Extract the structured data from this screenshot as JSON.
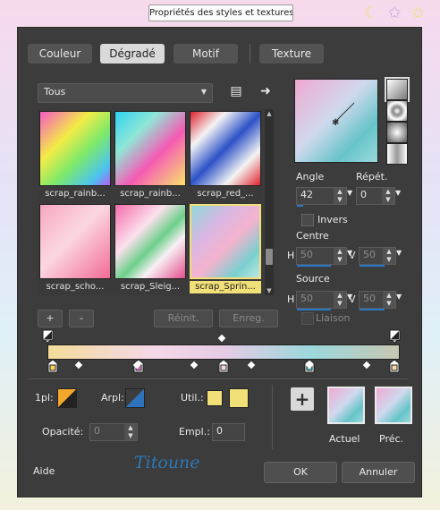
{
  "window": {
    "title": "Propriétés des styles et textures"
  },
  "title_icons": [
    "moon-icon",
    "star-icon",
    "star-icon"
  ],
  "tabs": [
    {
      "label": "Couleur",
      "active": false
    },
    {
      "label": "Dégradé",
      "active": true
    },
    {
      "label": "Motif",
      "active": false
    },
    {
      "label": "Texture",
      "active": false
    }
  ],
  "category": {
    "value": "Tous"
  },
  "thumbnails": [
    {
      "label": "scrap_rainb...",
      "selected": false
    },
    {
      "label": "scrap_rainb...",
      "selected": false
    },
    {
      "label": "scrap_red_...",
      "selected": false
    },
    {
      "label": "scrap_scho...",
      "selected": false
    },
    {
      "label": "scrap_Sleig...",
      "selected": false
    },
    {
      "label": "scrap_Sprin...",
      "selected": true
    }
  ],
  "list_buttons": {
    "add": "+",
    "remove": "-",
    "reset": "Réinit.",
    "save": "Enreg."
  },
  "angle": {
    "label": "Angle",
    "value": "42"
  },
  "repeat": {
    "label": "Répét.",
    "value": "0"
  },
  "invert": {
    "label": "Invers",
    "checked": false
  },
  "center": {
    "label": "Centre",
    "h_label": "H",
    "h": "50",
    "v_label": "V",
    "v": "50"
  },
  "source": {
    "label": "Source",
    "h_label": "H",
    "h": "50",
    "v_label": "V",
    "v": "50"
  },
  "link": {
    "label": "Liaison",
    "checked": false
  },
  "stops": {
    "color_stop_count": 5,
    "midpoint_count": 6,
    "stop_colors": [
      "#f4d35e",
      "#d978c6",
      "#f6d9e6",
      "#5bc7c9",
      "#f6d9a6"
    ]
  },
  "bottom": {
    "first_label": "1pl:",
    "arpl_label": "Arpl:",
    "util_label": "Util.:",
    "opacity_label": "Opacité:",
    "opacity_value": "0",
    "empl_label": "Empl.:",
    "empl_value": "0",
    "current_label": "Actuel",
    "prev_label": "Préc."
  },
  "footer": {
    "help": "Aide",
    "ok": "OK",
    "cancel": "Annuler",
    "watermark": "Titoune"
  }
}
